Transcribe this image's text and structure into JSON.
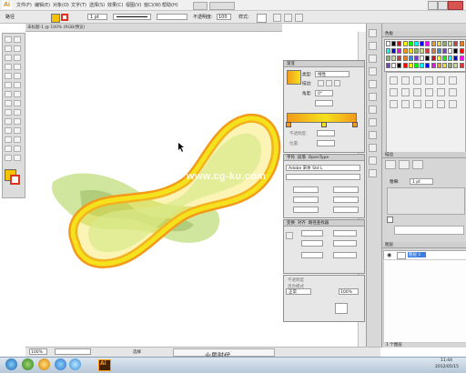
{
  "app": {
    "logo_text": "Ai",
    "accent_color": "#e07b00"
  },
  "menubar": {
    "items": [
      "文件(F)",
      "编辑(E)",
      "对象(O)",
      "文字(T)",
      "选择(S)",
      "效果(C)",
      "视图(V)",
      "窗口(W)",
      "帮助(H)"
    ]
  },
  "control_bar": {
    "selection_label": "路径",
    "stroke_weight": "1 pt",
    "opacity_label": "不透明度:",
    "opacity_value": "100",
    "style_label": "样式:"
  },
  "document_tab": {
    "title": "未标题-1 @ 100% (RGB/预览)"
  },
  "status_bar": {
    "zoom": "100%",
    "page_label": "选择"
  },
  "panels": {
    "gradient": {
      "title": "渐变",
      "type_label": "类型:",
      "type_value": "线性",
      "stroke_label": "描边:",
      "angle_label": "角度:",
      "angle_value": "0°",
      "opacity_label": "不透明度:",
      "location_label": "位置:"
    },
    "character": {
      "title": "字符",
      "tab2": "段落",
      "tab3": "OpenType",
      "font_value": "Adobe 宋体 Std L"
    },
    "transform": {
      "title": "变换",
      "tab2": "对齐",
      "tab3": "路径查找器"
    },
    "appearance": {
      "label_1": "不透明度",
      "label_2": "混合模式",
      "blend_value": "正常",
      "opacity_value": "100%"
    },
    "swatches": {
      "title": "色板"
    },
    "stroke": {
      "title": "描边",
      "weight_label": "粗细:",
      "weight_value": "1 pt"
    },
    "layers": {
      "title": "图层",
      "layer_name": "图层 1",
      "count": "1 个图层"
    }
  },
  "watermark": {
    "text": "www.cg-ku.com"
  },
  "bottom_mark": {
    "text": "火星时代"
  },
  "taskbar": {
    "clock_time": "11:44",
    "clock_date": "2012/05/15"
  },
  "colors": {
    "orange": "#f39a1a",
    "yellow": "#f4e21c",
    "light_green": "#c8e08c",
    "dark_green": "#8fb066"
  }
}
